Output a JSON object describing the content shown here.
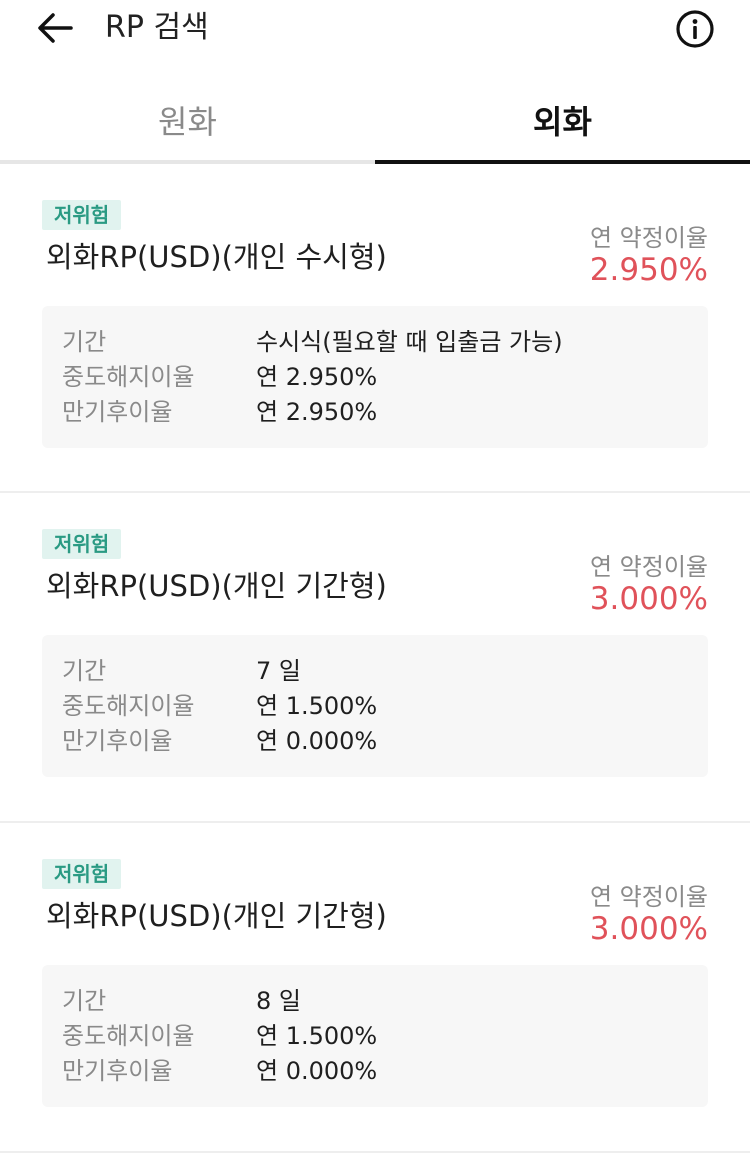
{
  "header": {
    "title": "RP 검색"
  },
  "tabs": [
    {
      "label": "원화",
      "active": false
    },
    {
      "label": "외화",
      "active": true
    }
  ],
  "products": [
    {
      "risk": "저위험",
      "name": "외화RP(USD)(개인 수시형)",
      "rate_label": "연 약정이율",
      "rate": "2.950%",
      "details": [
        {
          "label": "기간",
          "value": "수시식(필요할 때 입출금 가능)"
        },
        {
          "label": "중도해지이율",
          "value": "연 2.950%"
        },
        {
          "label": "만기후이율",
          "value": "연 2.950%"
        }
      ]
    },
    {
      "risk": "저위험",
      "name": "외화RP(USD)(개인 기간형)",
      "rate_label": "연 약정이율",
      "rate": "3.000%",
      "details": [
        {
          "label": "기간",
          "value": " 7 일"
        },
        {
          "label": "중도해지이율",
          "value": "연 1.500%"
        },
        {
          "label": "만기후이율",
          "value": "연 0.000%"
        }
      ]
    },
    {
      "risk": "저위험",
      "name": "외화RP(USD)(개인 기간형)",
      "rate_label": "연 약정이율",
      "rate": "3.000%",
      "details": [
        {
          "label": "기간",
          "value": " 8 일"
        },
        {
          "label": "중도해지이율",
          "value": "연 1.500%"
        },
        {
          "label": "만기후이율",
          "value": "연 0.000%"
        }
      ]
    }
  ],
  "colors": {
    "accent_rate": "#e0525a",
    "risk_badge_bg": "#e1f3ef",
    "risk_badge_text": "#2a9a83"
  },
  "icons": {
    "back": "arrow-left-icon",
    "info": "info-circle-icon"
  }
}
